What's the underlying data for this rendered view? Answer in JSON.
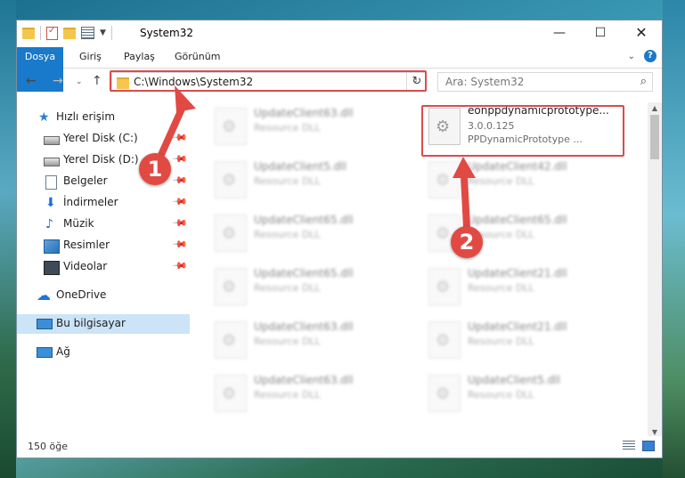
{
  "window": {
    "title": "System32",
    "controls": {
      "minimize": "—",
      "maximize": "☐",
      "close": "✕"
    }
  },
  "ribbon": {
    "tabs": [
      "Dosya",
      "Giriş",
      "Paylaş",
      "Görünüm"
    ],
    "accent_color": "#1979ca",
    "help": "?"
  },
  "address": {
    "path": "C:\\Windows\\System32",
    "search_placeholder": "Ara: System32"
  },
  "sidebar": {
    "items": [
      {
        "label": "Hızlı erişim",
        "icon": "star-icon"
      },
      {
        "label": "Yerel Disk (C:)",
        "icon": "drive-icon",
        "pinned": true
      },
      {
        "label": "Yerel Disk (D:)",
        "icon": "drive-icon",
        "pinned": true
      },
      {
        "label": "Belgeler",
        "icon": "documents-icon",
        "pinned": true
      },
      {
        "label": "İndirmeler",
        "icon": "download-icon",
        "pinned": true
      },
      {
        "label": "Müzik",
        "icon": "music-icon",
        "pinned": true
      },
      {
        "label": "Resimler",
        "icon": "pictures-icon",
        "pinned": true
      },
      {
        "label": "Videolar",
        "icon": "videos-icon",
        "pinned": true
      },
      {
        "label": "OneDrive",
        "icon": "cloud-icon"
      },
      {
        "label": "Bu bilgisayar",
        "icon": "computer-icon",
        "selected": true
      },
      {
        "label": "Ağ",
        "icon": "network-icon"
      }
    ]
  },
  "files": {
    "highlighted": {
      "name": "eonppdynamicprototype...",
      "version": "3.0.0.125",
      "description": "PPDynamicPrototype ..."
    },
    "left_column": [
      {
        "name": "UpdateClient63.dll",
        "type": "Resource DLL"
      },
      {
        "name": "UpdateClient5.dll",
        "type": "Resource DLL"
      },
      {
        "name": "UpdateClient65.dll",
        "type": "Resource DLL"
      },
      {
        "name": "UpdateClient65.dll",
        "type": "Resource DLL"
      },
      {
        "name": "UpdateClient63.dll",
        "type": "Resource DLL"
      },
      {
        "name": "UpdateClient63.dll",
        "type": "Resource DLL"
      }
    ],
    "right_column": [
      {
        "name": "UpdateClient42.dll",
        "type": "Resource DLL"
      },
      {
        "name": "UpdateClient65.dll",
        "type": "Resource DLL"
      },
      {
        "name": "UpdateClient21.dll",
        "type": "Resource DLL"
      },
      {
        "name": "UpdateClient21.dll",
        "type": "Resource DLL"
      },
      {
        "name": "UpdateClient5.dll",
        "type": "Resource DLL"
      }
    ]
  },
  "status": {
    "item_count": "150 öğe"
  },
  "annotations": {
    "step1": "1",
    "step2": "2",
    "color": "#e14a43"
  }
}
